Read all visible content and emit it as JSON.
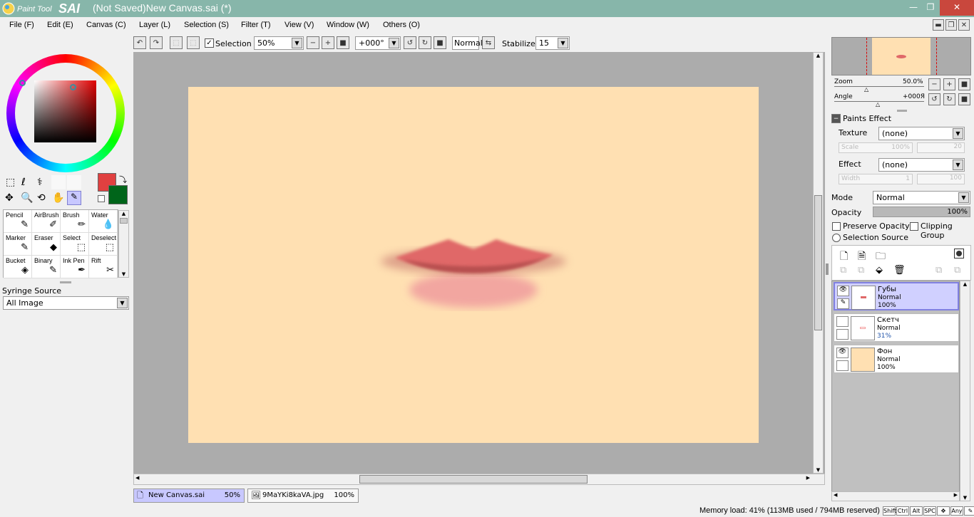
{
  "window": {
    "logo_text": "Paint Tool SAI",
    "title": "(Not Saved)New Canvas.sai (*)",
    "minimize": "—",
    "maximize": "❐",
    "close": "✕"
  },
  "menu": [
    {
      "label": "File (F)"
    },
    {
      "label": "Edit (E)"
    },
    {
      "label": "Canvas (C)"
    },
    {
      "label": "Layer (L)"
    },
    {
      "label": "Selection (S)"
    },
    {
      "label": "Filter (T)"
    },
    {
      "label": "View (V)"
    },
    {
      "label": "Window (W)"
    },
    {
      "label": "Others (O)"
    }
  ],
  "toolbar": {
    "selection_label": "Selection",
    "selection_checked": true,
    "zoom": "50%",
    "angle": "+000°",
    "blend": "Normal",
    "stabilizer_label": "Stabilizer",
    "stabilizer_value": "15"
  },
  "colors": {
    "primary": "#e04040",
    "secondary": "#00651a",
    "canvas_bg": "#ffe0b2",
    "titlebar": "#87b6aa",
    "close_btn": "#c9473d"
  },
  "tools": [
    {
      "label": "Pencil",
      "icon": "pencil-icon",
      "glyph": "✎"
    },
    {
      "label": "AirBrush",
      "icon": "airbrush-icon",
      "glyph": "✐"
    },
    {
      "label": "Brush",
      "icon": "brush-icon",
      "glyph": "✏"
    },
    {
      "label": "Water",
      "icon": "water-icon",
      "glyph": "💧"
    },
    {
      "label": "Marker",
      "icon": "marker-icon",
      "glyph": "✎"
    },
    {
      "label": "Eraser",
      "icon": "eraser-icon",
      "glyph": "◆"
    },
    {
      "label": "Select",
      "icon": "select-icon",
      "glyph": "⬚"
    },
    {
      "label": "Deselect",
      "icon": "deselect-icon",
      "glyph": "⬚"
    },
    {
      "label": "Bucket",
      "icon": "bucket-icon",
      "glyph": "◈"
    },
    {
      "label": "Binary",
      "icon": "binary-icon",
      "glyph": "✎"
    },
    {
      "label": "Ink Pen",
      "icon": "ink-pen-icon",
      "glyph": "✒"
    },
    {
      "label": "Rift",
      "icon": "rift-icon",
      "glyph": "✂"
    }
  ],
  "syringe": {
    "label": "Syringe Source",
    "value": "All Image"
  },
  "navigator": {
    "zoom_label": "Zoom",
    "zoom_value": "50.0%",
    "angle_label": "Angle",
    "angle_value": "+000Я"
  },
  "paints_effect": {
    "title": "Paints Effect",
    "texture_label": "Texture",
    "texture_value": "(none)",
    "scale_label": "Scale",
    "scale_value": "100%",
    "scale_num": "20",
    "effect_label": "Effect",
    "effect_value": "(none)",
    "width_label": "Width",
    "width_value": "1",
    "width_num": "100"
  },
  "layer_props": {
    "mode_label": "Mode",
    "mode_value": "Normal",
    "opacity_label": "Opacity",
    "opacity_value": "100%",
    "preserve_opacity": "Preserve Opacity",
    "clipping_group": "Clipping Group",
    "selection_source": "Selection Source"
  },
  "layers": [
    {
      "name": "Губы",
      "mode": "Normal",
      "opacity": "100%",
      "visible": true,
      "selected": true
    },
    {
      "name": "Скетч",
      "mode": "Normal",
      "opacity": "31%",
      "visible": false,
      "selected": false
    },
    {
      "name": "Фон",
      "mode": "Normal",
      "opacity": "100%",
      "visible": true,
      "selected": false
    }
  ],
  "tabs": [
    {
      "name": "New Canvas.sai",
      "zoom": "50%",
      "active": true
    },
    {
      "name": "9MaYKi8kaVA.jpg",
      "zoom": "100%",
      "active": false
    }
  ],
  "status": {
    "memory": "Memory load: 41% (113MB used / 794MB reserved)",
    "keys": [
      "Shift",
      "Ctrl",
      "Alt",
      "SPC",
      "✥",
      "Any",
      "✎"
    ]
  }
}
